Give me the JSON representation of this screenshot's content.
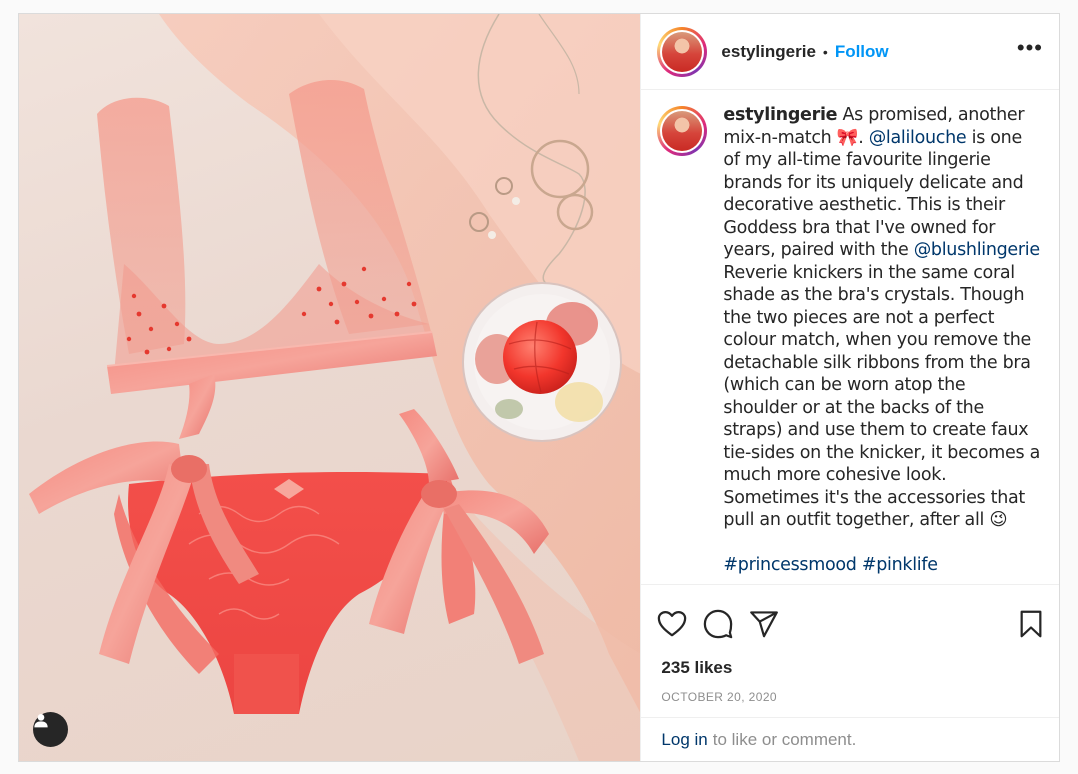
{
  "post": {
    "username": "estylingerie",
    "follow_label": "Follow",
    "separator": "•",
    "more_label": "•••",
    "caption": {
      "username": "estylingerie",
      "part1": " As promised, another mix-n-match 🎀. ",
      "mention1": "@lalilouche",
      "part2": " is one of my all-time favourite lingerie brands for its uniquely delicate and decorative aesthetic. This is their Goddess bra that I've owned for years, paired with the ",
      "mention2": "@blushlingerie",
      "part3": " Reverie knickers in the same coral shade as the bra's crystals. Though the two pieces are not a perfect colour match, when you remove the detachable silk ribbons from the bra (which can be worn atop the shoulder or at the backs of the straps) and use them to create faux tie-sides on the knicker, it becomes a much more cohesive look. Sometimes it's the accessories that pull an outfit together, after all 😉",
      "hashtag1": "#princessmood",
      "hashtag2": "#pinklife"
    },
    "likes": "235 likes",
    "date": "OCTOBER 20, 2020",
    "login_link": "Log in",
    "login_text": "to like or comment."
  },
  "icons": {
    "like": "heart-icon",
    "comment": "comment-icon",
    "share": "share-icon",
    "save": "bookmark-icon",
    "tagged": "user-icon",
    "more": "more-icon"
  },
  "colors": {
    "link_blue": "#0095f6",
    "mention": "#00376b",
    "secondary_text": "#8e8e8e"
  }
}
